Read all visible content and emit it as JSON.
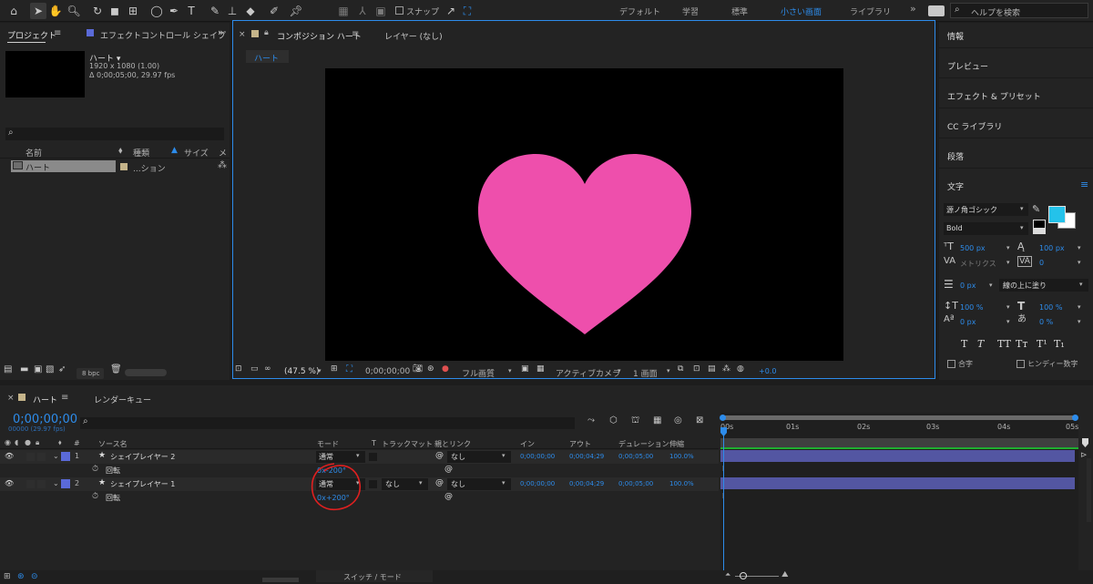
{
  "toolbar": {
    "snap_label": "スナップ",
    "workspaces": [
      "デフォルト",
      "学習",
      "標準",
      "小さい画面",
      "ライブラリ"
    ],
    "active_workspace": "小さい画面",
    "more": "»",
    "search_placeholder": "ヘルプを検索"
  },
  "project": {
    "tab_label": "プロジェクト",
    "tab2_label": "エフェクトコントロール シェイプ",
    "item_name": "ハート ▾",
    "item_dims": "1920 x 1080 (1.00)",
    "item_time": "Δ 0;00;05;00, 29.97 fps",
    "col_name": "名前",
    "col_type": "種類",
    "col_size": "サイズ",
    "col_more": "メ",
    "row_name": "ハート",
    "row_type": "...ション",
    "bpc": "8 bpc"
  },
  "comp": {
    "tab_label": "コンポジション ハート",
    "layer_tab": "レイヤー (なし)",
    "breadcrumb": "ハート",
    "zoom": "(47.5 %)",
    "timecode": "0;00;00;00",
    "resolution": "フル画質",
    "camera": "アクティブカメラ",
    "views": "1 画面",
    "exposure": "+0.0",
    "heart_color": "#ee4fac"
  },
  "right_panel": {
    "items": [
      "情報",
      "プレビュー",
      "エフェクト & プリセット",
      "CC ライブラリ",
      "段落"
    ],
    "char_title": "文字",
    "font": "源ノ角ゴシック",
    "style": "Bold",
    "font_size": "500 px",
    "leading": "100 px",
    "kerning": "メトリクス",
    "tracking": "0",
    "stroke_width": "0 px",
    "stroke_mode": "線の上に塗り",
    "v_scale": "100 %",
    "h_scale": "100 %",
    "baseline": "0 px",
    "tsume": "0 %",
    "ligature": "合字",
    "hindi": "ヒンディー数字",
    "fill_color": "#24c2ea"
  },
  "timeline": {
    "tab_label": "ハート",
    "render_tab": "レンダーキュー",
    "timecode": "0;00;00;00",
    "frame_info": "00000 (29.97 fps)",
    "cols": {
      "source": "ソース名",
      "mode": "モード",
      "t": "T",
      "track": "トラックマット",
      "parent": "親とリンク",
      "in": "イン",
      "out": "アウト",
      "duration": "デュレーション",
      "stretch": "伸縮"
    },
    "layers": [
      {
        "num": "1",
        "name": "シェイプレイヤー 2",
        "mode": "通常",
        "parent": "なし",
        "in": "0;00;00;00",
        "out": "0;00;04;29",
        "duration": "0;00;05;00",
        "stretch": "100.0%",
        "prop": "回転",
        "prop_value": "0x-200°",
        "track": ""
      },
      {
        "num": "2",
        "name": "シェイプレイヤー 1",
        "mode": "通常",
        "parent": "なし",
        "in": "0;00;00;00",
        "out": "0;00;04;29",
        "duration": "0;00;05;00",
        "stretch": "100.0%",
        "prop": "回転",
        "prop_value": "0x+200°",
        "track": "なし"
      }
    ],
    "ruler": [
      "00s",
      "01s",
      "02s",
      "03s",
      "04s",
      "05s"
    ],
    "footer": "スイッチ / モード"
  }
}
